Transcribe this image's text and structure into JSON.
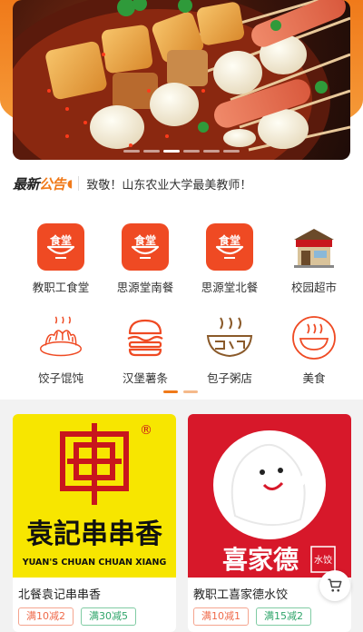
{
  "banner": {
    "slide_count": 6,
    "active_slide": 2
  },
  "notice": {
    "logo_main": "最新",
    "logo_accent": "公告",
    "text": "致敬！山东农业大学最美教师！"
  },
  "categories": [
    {
      "label": "教职工食堂",
      "icon": "canteen-icon"
    },
    {
      "label": "思源堂南餐",
      "icon": "canteen-icon"
    },
    {
      "label": "思源堂北餐",
      "icon": "canteen-icon"
    },
    {
      "label": "校园超市",
      "icon": "supermarket-icon"
    },
    {
      "label": "饺子馄饨",
      "icon": "dumpling-icon"
    },
    {
      "label": "汉堡薯条",
      "icon": "burger-icon"
    },
    {
      "label": "包子粥店",
      "icon": "porridge-icon"
    },
    {
      "label": "美食",
      "icon": "food-bowl-icon"
    }
  ],
  "canteen_icon_text": "食堂",
  "page_indicator": {
    "pages": 2,
    "active": 0
  },
  "shops": [
    {
      "name": "北餐袁记串串香",
      "logo_text_cn": "袁記串串香",
      "logo_text_en": "YUAN'S  CHUAN CHUAN XIANG",
      "logo_mark": "®",
      "tags": [
        "满10减2",
        "满30减5"
      ]
    },
    {
      "name": "教职工喜家德水饺",
      "logo_text_cn": "喜家德",
      "logo_badge": "水饺",
      "tags": [
        "满10减1",
        "满15减2"
      ]
    }
  ],
  "colors": {
    "accent": "#f07a1a",
    "canteen_red": "#ef4a23",
    "tag_red": "#ef6a4a",
    "tag_green": "#2fa56a",
    "yuan_yellow": "#f7e600",
    "xjd_red": "#d7182a"
  }
}
